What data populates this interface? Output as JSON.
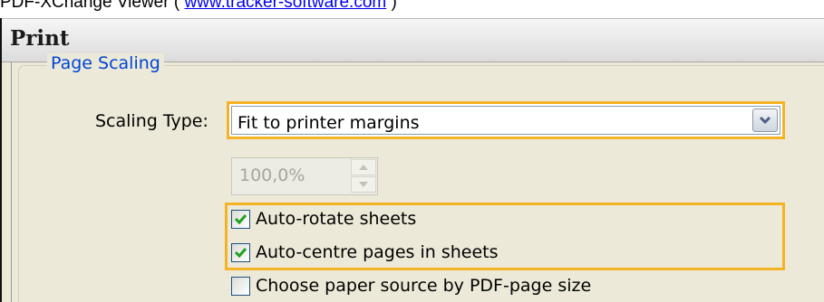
{
  "caption": {
    "prefix": "PDF-XChange Viewer ( ",
    "link": "www.tracker-software.com",
    "suffix": " )"
  },
  "dialog": {
    "title": "Print"
  },
  "page_scaling": {
    "group_label": "Page Scaling",
    "scaling_type_label": "Scaling Type:",
    "scaling_type_value": "Fit to printer margins",
    "percent_value": "100,0%",
    "options": [
      {
        "label": "Auto-rotate sheets",
        "checked": true
      },
      {
        "label": "Auto-centre pages in sheets",
        "checked": true
      },
      {
        "label": "Choose paper source by PDF-page size",
        "checked": false
      }
    ]
  },
  "colors": {
    "highlight": "#f5b324",
    "check": "#21a121",
    "group_label": "#0046d5"
  },
  "icons": {
    "dropdown": "chevron-down-icon",
    "spin_up": "triangle-up-icon",
    "spin_down": "triangle-down-icon",
    "checkmark": "checkmark-icon"
  }
}
